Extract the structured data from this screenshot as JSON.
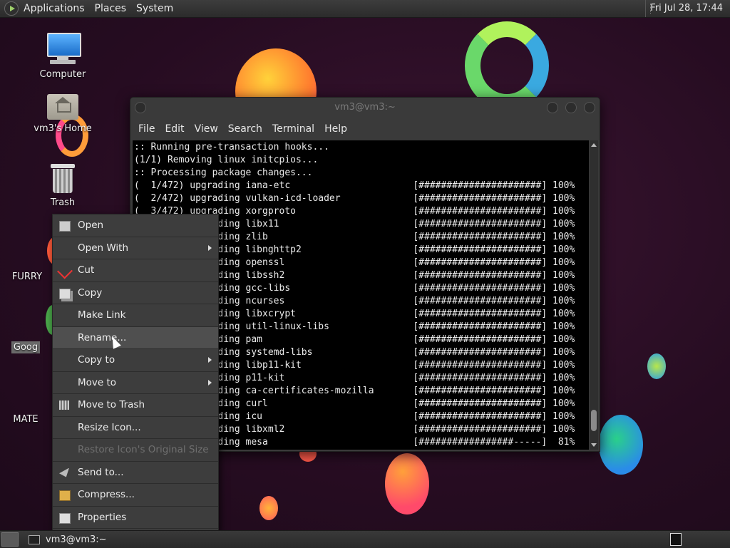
{
  "top_panel": {
    "menus": [
      "Applications",
      "Places",
      "System"
    ],
    "clock": "Fri Jul 28, 17:44"
  },
  "desktop_icons": [
    {
      "label": "Computer",
      "icon": "computer-icon"
    },
    {
      "label": "vm3's Home",
      "icon": "home-folder-icon"
    },
    {
      "label": "Trash",
      "icon": "trash-icon"
    },
    {
      "label": "FURRY",
      "icon": "app-icon"
    },
    {
      "label": "Goog",
      "icon": "google-chrome-icon"
    },
    {
      "label": "MATE",
      "icon": "document-icon"
    }
  ],
  "terminal": {
    "title": "vm3@vm3:~",
    "menus": [
      "File",
      "Edit",
      "View",
      "Search",
      "Terminal",
      "Help"
    ],
    "lines": [
      ":: Running pre-transaction hooks...",
      "(1/1) Removing linux initcpios...",
      ":: Processing package changes...",
      "(  1/472) upgrading iana-etc                      [######################] 100%",
      "(  2/472) upgrading vulkan-icd-loader             [######################] 100%",
      "(  3/472) upgrading xorgproto                     [######################] 100%",
      "(  4/472) upgrading libx11                        [######################] 100%",
      "(  5/472) upgrading zlib                          [######################] 100%",
      "(  6/472) upgrading libnghttp2                    [######################] 100%",
      "(  7/472) upgrading openssl                       [######################] 100%",
      "(  8/472) upgrading libssh2                       [######################] 100%",
      "(  9/472) upgrading gcc-libs                      [######################] 100%",
      "( 10/472) upgrading ncurses                       [######################] 100%",
      "( 11/472) upgrading libxcrypt                     [######################] 100%",
      "( 12/472) upgrading util-linux-libs               [######################] 100%",
      "( 13/472) upgrading pam                           [######################] 100%",
      "( 14/472) upgrading systemd-libs                  [######################] 100%",
      "( 15/472) upgrading libp11-kit                    [######################] 100%",
      "( 16/472) upgrading p11-kit                       [######################] 100%",
      "( 17/472) upgrading ca-certificates-mozilla       [######################] 100%",
      "( 18/472) upgrading curl                          [######################] 100%",
      "( 19/472) upgrading icu                           [######################] 100%",
      "( 20/472) upgrading libxml2                       [######################] 100%",
      "( 21/472) upgrading mesa                          [#################-----]  81%"
    ]
  },
  "context_menu": {
    "items": [
      {
        "label": "Open",
        "icon": "open-icon",
        "submenu": false,
        "disabled": false
      },
      {
        "label": "Open With",
        "icon": "",
        "submenu": true,
        "disabled": false
      },
      {
        "label": "Cut",
        "icon": "scissors-icon",
        "submenu": false,
        "disabled": false
      },
      {
        "label": "Copy",
        "icon": "copy-icon",
        "submenu": false,
        "disabled": false
      },
      {
        "label": "Make Link",
        "icon": "",
        "submenu": false,
        "disabled": false
      },
      {
        "label": "Rename...",
        "icon": "",
        "submenu": false,
        "disabled": false,
        "hover": true
      },
      {
        "label": "Copy to",
        "icon": "",
        "submenu": true,
        "disabled": false
      },
      {
        "label": "Move to",
        "icon": "",
        "submenu": true,
        "disabled": false
      },
      {
        "label": "Move to Trash",
        "icon": "trash-icon",
        "submenu": false,
        "disabled": false
      },
      {
        "label": "Resize Icon...",
        "icon": "",
        "submenu": false,
        "disabled": false
      },
      {
        "label": "Restore Icon's Original Size",
        "icon": "",
        "submenu": false,
        "disabled": true
      },
      {
        "label": "Send to...",
        "icon": "send-icon",
        "submenu": false,
        "disabled": false
      },
      {
        "label": "Compress...",
        "icon": "archive-icon",
        "submenu": false,
        "disabled": false
      },
      {
        "label": "Properties",
        "icon": "properties-icon",
        "submenu": false,
        "disabled": false
      }
    ]
  },
  "bottom_panel": {
    "task_label": "vm3@vm3:~"
  },
  "colors": {
    "panel": "#2b2b2b",
    "menu_bg": "#3d3d3d",
    "terminal_bg": "#000000",
    "wallpaper": "#2a0f24"
  }
}
